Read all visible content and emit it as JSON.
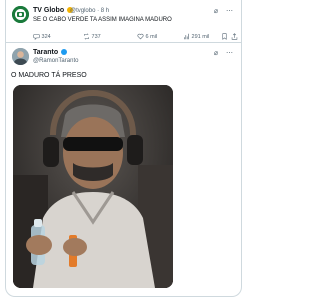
{
  "quoted_post": {
    "author_name": "TV Globo",
    "handle": "@tvglobo",
    "time": "8 h",
    "text": "SE O CABO VERDE TA ASSIM IMAGINA MADURO",
    "replies": "324",
    "reposts": "737",
    "likes": "6 mil",
    "views": "291 mil"
  },
  "post": {
    "author_name": "Taranto",
    "handle": "@RamonTaranto",
    "text": "O MADURO TÁ PRESO"
  },
  "colors": {
    "verified_gold": "#f4b300",
    "verified_blue": "#1d9bf0",
    "muted_text": "#536471",
    "border": "#cfd9de"
  }
}
